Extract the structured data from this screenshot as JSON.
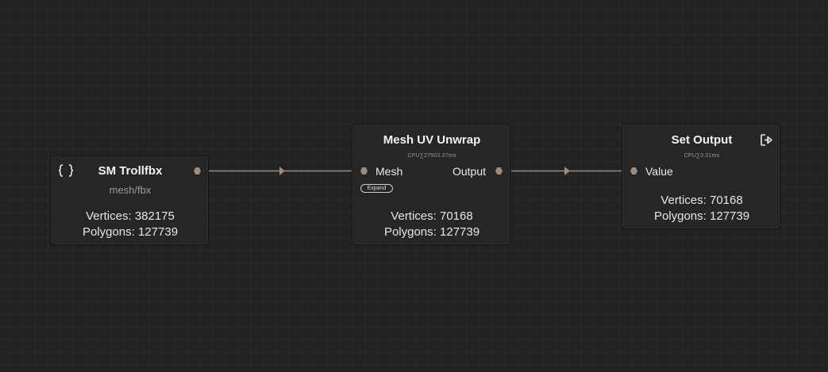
{
  "nodes": {
    "source": {
      "title": "SM Trollfbx",
      "subtitle": "mesh/fbx",
      "icon": "curly-braces-icon",
      "vertices": "Vertices: 382175",
      "polygons": "Polygons: 127739"
    },
    "unwrap": {
      "title": "Mesh UV Unwrap",
      "cpu": "CPU∑27503.37ms",
      "input_label": "Mesh",
      "output_label": "Output",
      "expand_label": "Expand",
      "vertices": "Vertices: 70168",
      "polygons": "Polygons: 127739"
    },
    "output": {
      "title": "Set Output",
      "cpu": "CPU∑0.01ms",
      "icon": "export-icon",
      "input_label": "Value",
      "vertices": "Vertices: 70168",
      "polygons": "Polygons: 127739"
    }
  },
  "colors": {
    "canvas": "#222222",
    "grid": "#2b2b2b",
    "node": "#262626",
    "wire": "#9b8c82"
  }
}
